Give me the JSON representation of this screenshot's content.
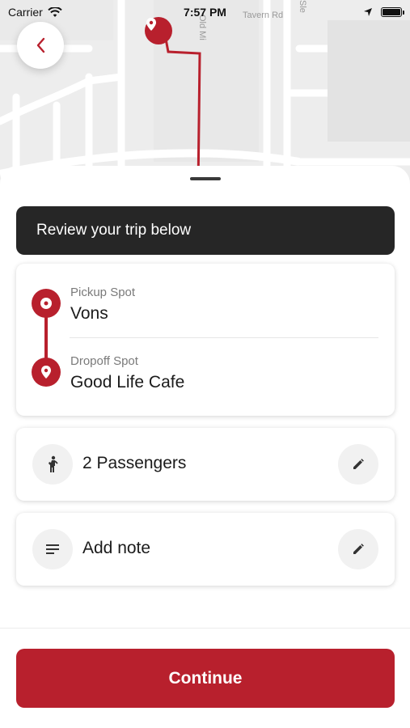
{
  "status_bar": {
    "carrier": "Carrier",
    "time": "7:57 PM"
  },
  "map": {
    "street_labels": [
      "Tavern Rd",
      "Old Mi",
      "Sle"
    ]
  },
  "review_banner": "Review your trip below",
  "trip": {
    "pickup_label": "Pickup Spot",
    "pickup_value": "Vons",
    "dropoff_label": "Dropoff Spot",
    "dropoff_value": "Good Life Cafe"
  },
  "passengers": {
    "text": "2 Passengers"
  },
  "note": {
    "text": "Add note"
  },
  "continue_label": "Continue",
  "colors": {
    "brand": "#b8202d",
    "banner": "#262626"
  },
  "icons": {
    "back": "chevron-left-icon",
    "passenger": "person-icon",
    "note": "notes-icon",
    "edit": "pencil-icon"
  }
}
